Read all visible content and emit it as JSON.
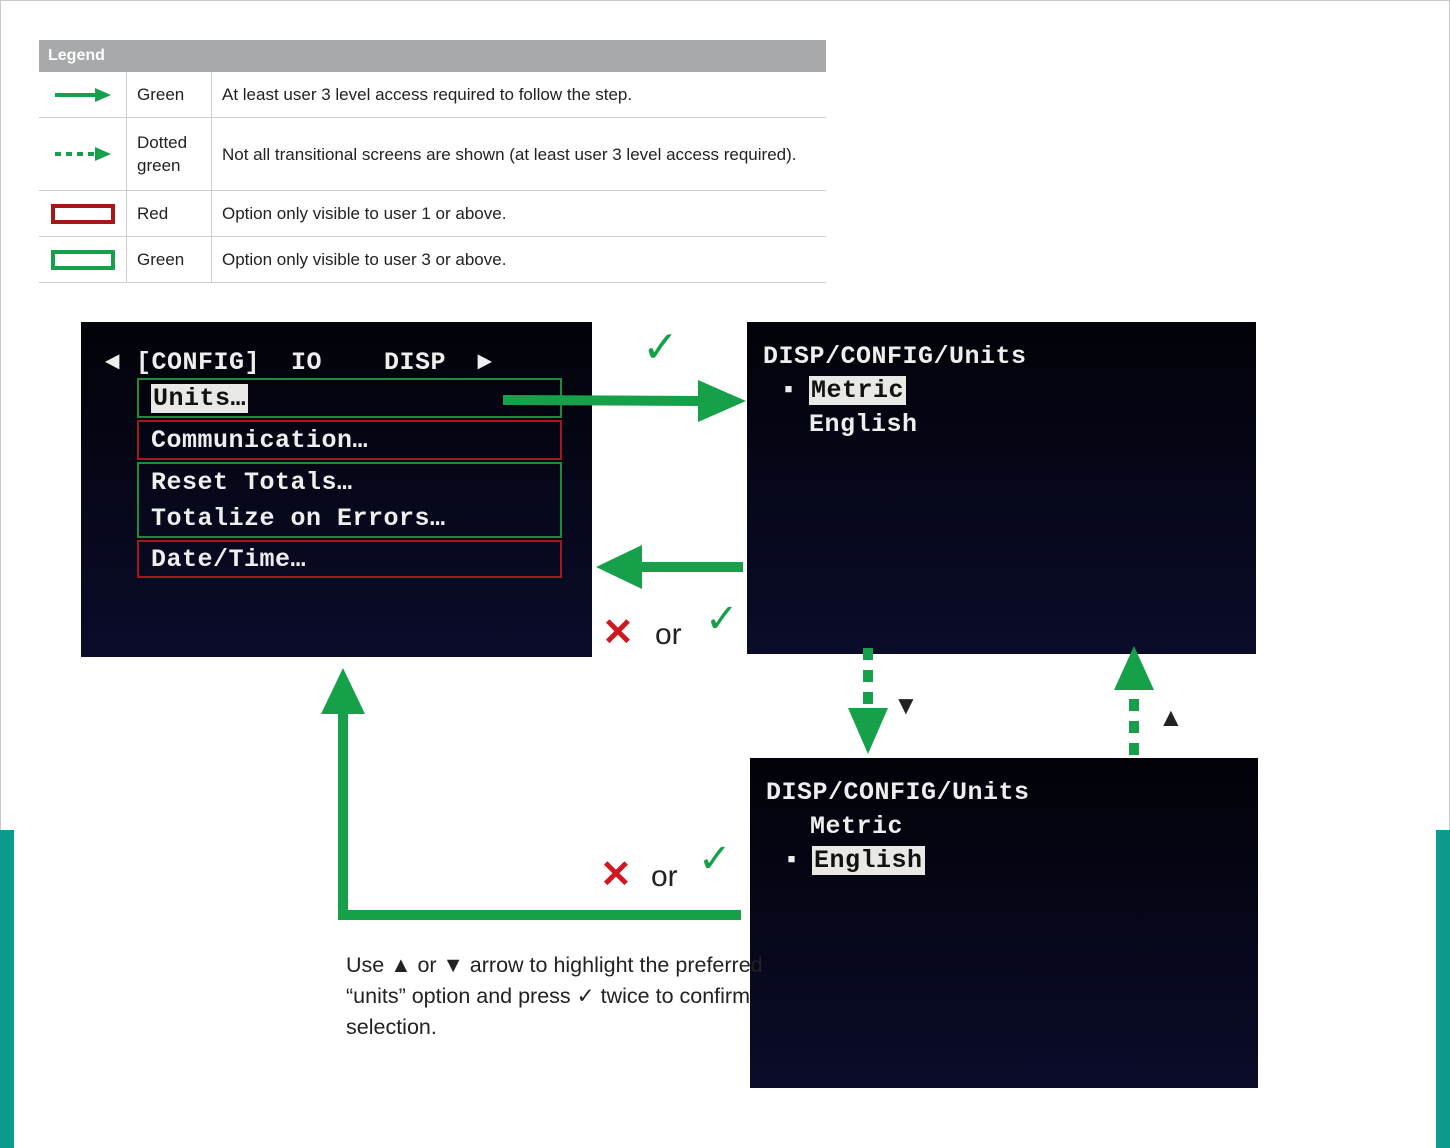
{
  "legend": {
    "title": "Legend",
    "rows": [
      {
        "icon": "solid-green-arrow-icon",
        "label": "Green",
        "desc": "At least user 3 level access required to follow the step."
      },
      {
        "icon": "dotted-green-arrow-icon",
        "label": "Dotted green",
        "desc": "Not all transitional screens are shown (at least user 3 level access required)."
      },
      {
        "icon": "red-box-icon",
        "label": "Red",
        "desc": "Option only visible to user 1 or above."
      },
      {
        "icon": "green-box-icon",
        "label": "Green",
        "desc": "Option only visible to user 3 or above."
      }
    ]
  },
  "screen_config": {
    "menu_bar": "◄ [CONFIG]  IO    DISP  ►",
    "items": [
      "Units…",
      "Communication…",
      "Reset Totals…",
      "Totalize on Errors…",
      "Date/Time…"
    ]
  },
  "screen_units_metric": {
    "title": "DISP/CONFIG/Units",
    "options": [
      "Metric",
      "English"
    ],
    "selected": "Metric"
  },
  "screen_units_english": {
    "title": "DISP/CONFIG/Units",
    "options": [
      "Metric",
      "English"
    ],
    "selected": "English"
  },
  "symbols": {
    "check": "✓",
    "cross": "✕",
    "or": "or",
    "up": "▲",
    "down": "▼",
    "bullet": "▪"
  },
  "caption": "Use ▲ or ▼ arrow to highlight the preferred “units” option and press ✓ twice to confirm selection.",
  "colors": {
    "green": "#17a04a",
    "red": "#d0161e",
    "teal": "#0b9a8c",
    "legend_header": "#a7a9ab"
  }
}
